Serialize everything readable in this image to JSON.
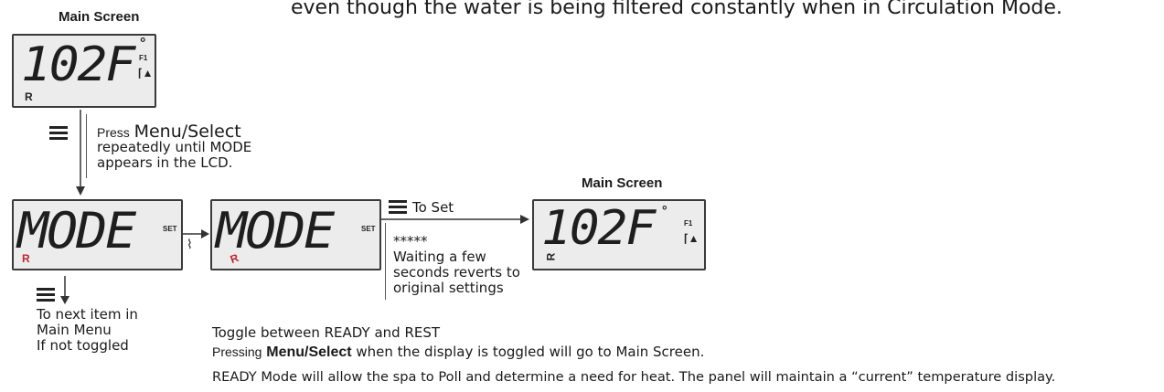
{
  "top_text": "even though the water is being filtered constantly when in Circulation Mode.",
  "main_screen_label": "Main Screen",
  "lcd1": {
    "digits": "102F",
    "degree": "°",
    "f1": "F1",
    "r": "R",
    "temp_icon": "thermometer-up-icon"
  },
  "press_text": {
    "press": "Press",
    "menu_select": "Menu/Select",
    "line2": "repeatedly until MODE",
    "line3": "appears in the LCD."
  },
  "lcd2": {
    "digits": "MODE",
    "set": "SET",
    "r": "R"
  },
  "lcd3": {
    "digits": "MODE",
    "set": "SET",
    "r": "R"
  },
  "to_set": "To Set",
  "stars": "*****",
  "waiting": {
    "line1": "Waiting a few",
    "line2": "seconds reverts to",
    "line3": "original settings"
  },
  "main_screen_label2": "Main Screen",
  "lcd4": {
    "digits": "102F",
    "degree": "°",
    "f1": "F1",
    "r": "R"
  },
  "next_item": {
    "line1": "To next item in",
    "line2": "Main Menu",
    "line3": "If not toggled"
  },
  "toggle_text": "Toggle between READY and REST",
  "pressing": {
    "pressing": "Pressing",
    "menu_select": "Menu/Select",
    "rest": "when the display is toggled will go to Main Screen."
  },
  "ready_text": "READY Mode will allow the spa to Poll and determine a need for heat. The panel will maintain a “current” temperature display.",
  "colors": {
    "accent_red": "#c0282d",
    "lcd_bg": "#ececec",
    "text": "#1a1a1a"
  }
}
